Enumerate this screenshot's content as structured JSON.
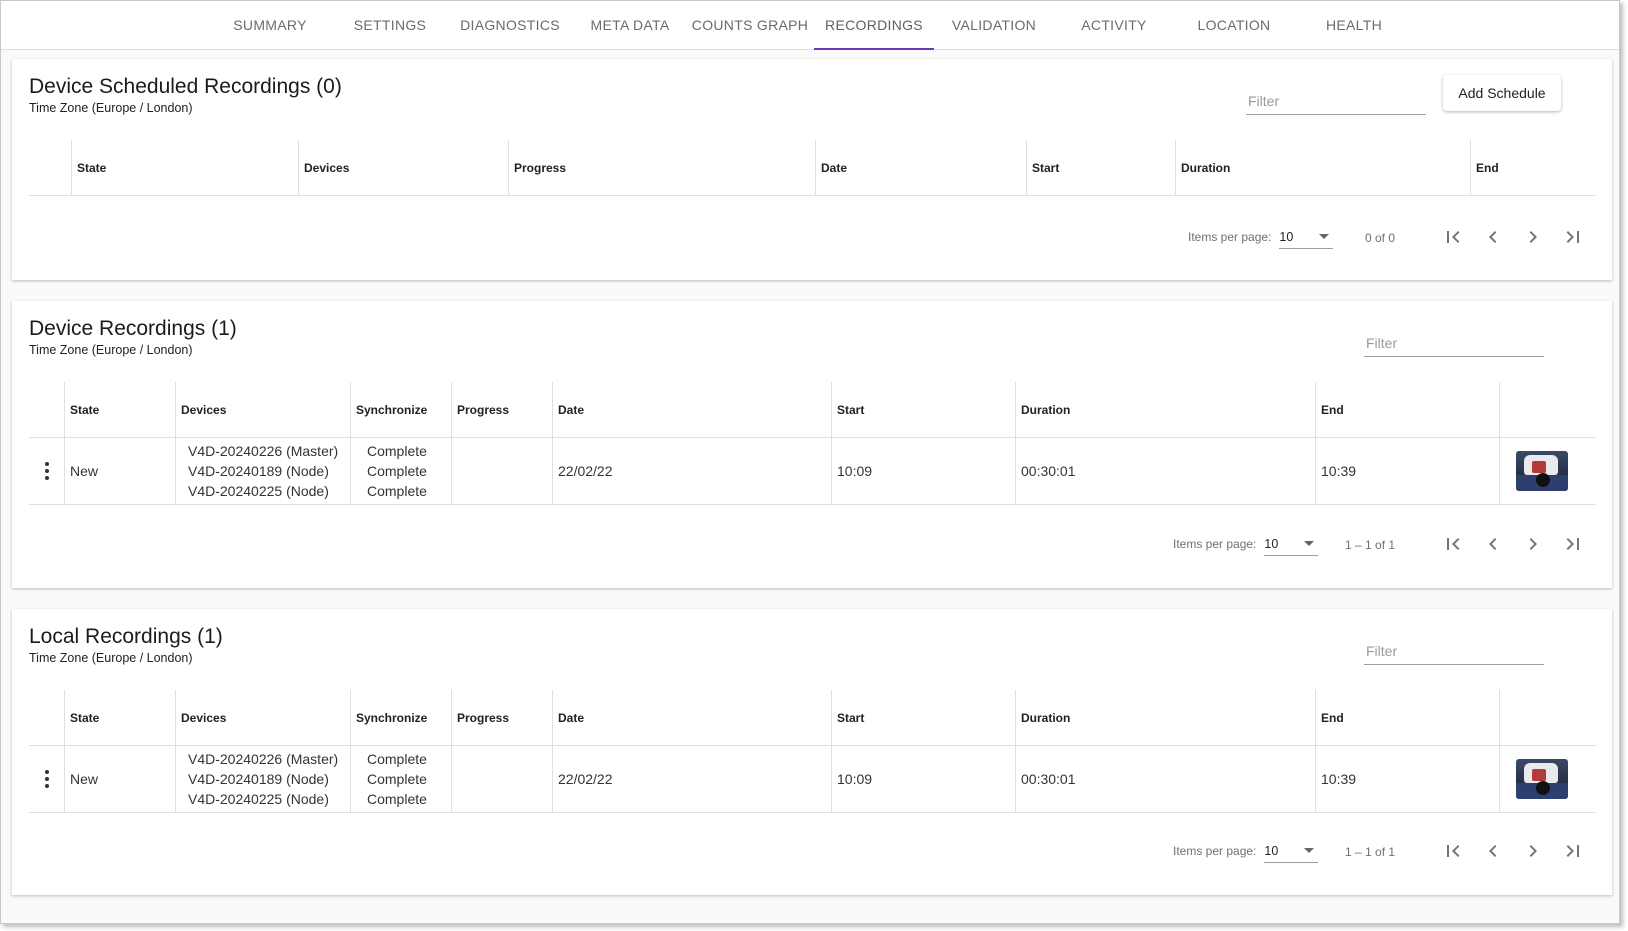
{
  "tabs": [
    {
      "label": "SUMMARY"
    },
    {
      "label": "SETTINGS"
    },
    {
      "label": "DIAGNOSTICS"
    },
    {
      "label": "META DATA"
    },
    {
      "label": "COUNTS GRAPH"
    },
    {
      "label": "RECORDINGS",
      "active": true
    },
    {
      "label": "VALIDATION"
    },
    {
      "label": "ACTIVITY"
    },
    {
      "label": "LOCATION"
    },
    {
      "label": "HEALTH"
    }
  ],
  "scheduled": {
    "title": "Device Scheduled Recordings (0)",
    "timezone": "Time Zone (Europe / London)",
    "filter_placeholder": "Filter",
    "add_button": "Add Schedule",
    "columns": [
      "State",
      "Devices",
      "Progress",
      "Date",
      "Start",
      "Duration",
      "End"
    ],
    "pager": {
      "items_label": "Items per page:",
      "page_size": "10",
      "range": "0 of 0"
    }
  },
  "device_recordings": {
    "title": "Device Recordings (1)",
    "timezone": "Time Zone (Europe / London)",
    "filter_placeholder": "Filter",
    "columns": [
      "State",
      "Devices",
      "Synchronize",
      "Progress",
      "Date",
      "Start",
      "Duration",
      "End"
    ],
    "rows": [
      {
        "state": "New",
        "devices": [
          "V4D-20240226 (Master)",
          "V4D-20240189 (Node)",
          "V4D-20240225 (Node)"
        ],
        "sync": [
          "Complete",
          "Complete",
          "Complete"
        ],
        "progress": "",
        "date": "22/02/22",
        "start": "10:09",
        "duration": "00:30:01",
        "end": "10:39"
      }
    ],
    "pager": {
      "items_label": "Items per page:",
      "page_size": "10",
      "range": "1 – 1 of 1"
    }
  },
  "local_recordings": {
    "title": "Local Recordings (1)",
    "timezone": "Time Zone (Europe / London)",
    "filter_placeholder": "Filter",
    "columns": [
      "State",
      "Devices",
      "Synchronize",
      "Progress",
      "Date",
      "Start",
      "Duration",
      "End"
    ],
    "rows": [
      {
        "state": "New",
        "devices": [
          "V4D-20240226 (Master)",
          "V4D-20240189 (Node)",
          "V4D-20240225 (Node)"
        ],
        "sync": [
          "Complete",
          "Complete",
          "Complete"
        ],
        "progress": "",
        "date": "22/02/22",
        "start": "10:09",
        "duration": "00:30:01",
        "end": "10:39"
      }
    ],
    "pager": {
      "items_label": "Items per page:",
      "page_size": "10",
      "range": "1 – 1 of 1"
    }
  },
  "icons": {
    "row_menu": "more-vert-icon",
    "first_page": "first-page-icon",
    "prev_page": "chevron-left-icon",
    "next_page": "chevron-right-icon",
    "last_page": "last-page-icon",
    "dropdown": "caret-down-icon",
    "thumbnail": "video-thumbnail"
  },
  "colors": {
    "accent": "#673ab7",
    "divider": "#e0e0e0",
    "tab_text": "#6b6b6b"
  }
}
